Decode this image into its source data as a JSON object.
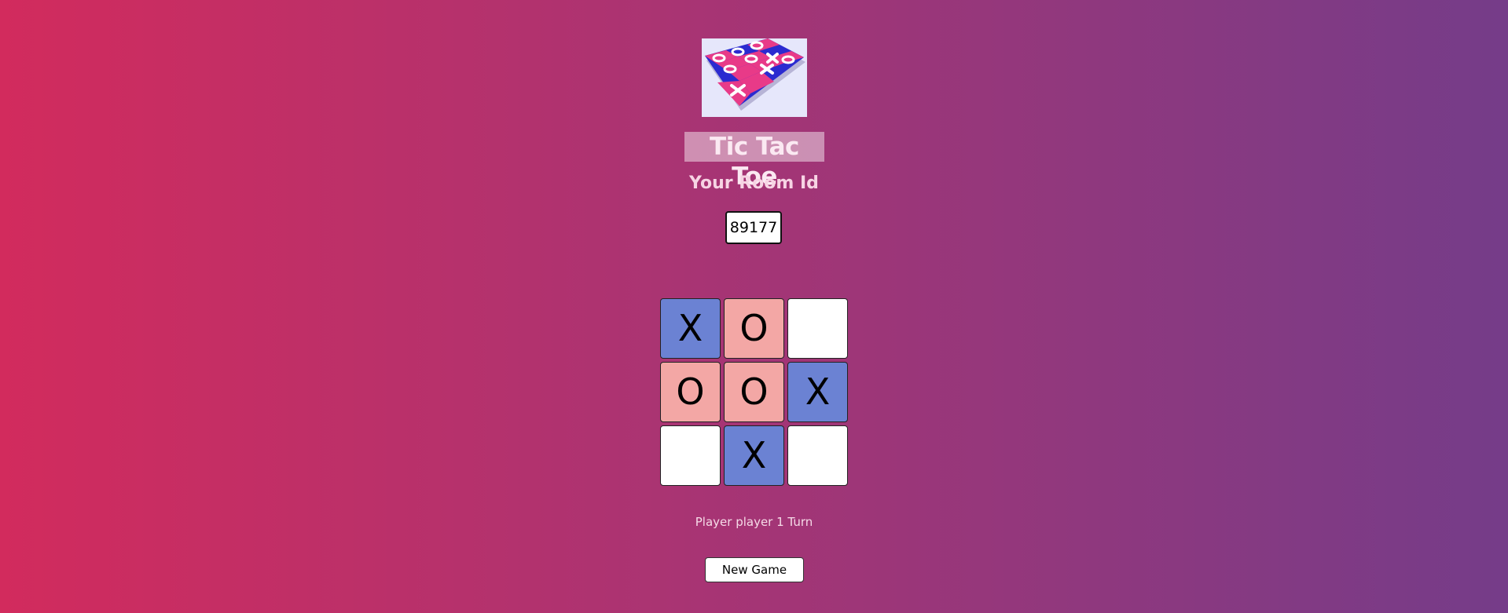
{
  "header": {
    "title": "Tic Tac Toe",
    "room_label": "Your Room Id",
    "room_id": "89177"
  },
  "board": {
    "cells": [
      "X",
      "O",
      "",
      "O",
      "O",
      "X",
      "",
      "X",
      ""
    ]
  },
  "status": {
    "text": "Player player 1 Turn"
  },
  "actions": {
    "new_game_label": "New Game"
  },
  "colors": {
    "x_cell": "#6b82d3",
    "o_cell": "#f3a7a5",
    "empty_cell": "#ffffff",
    "bg_start": "#d22b5d",
    "bg_end": "#753c89"
  },
  "icons": {
    "logo": "tic-tac-toe-board-logo"
  }
}
